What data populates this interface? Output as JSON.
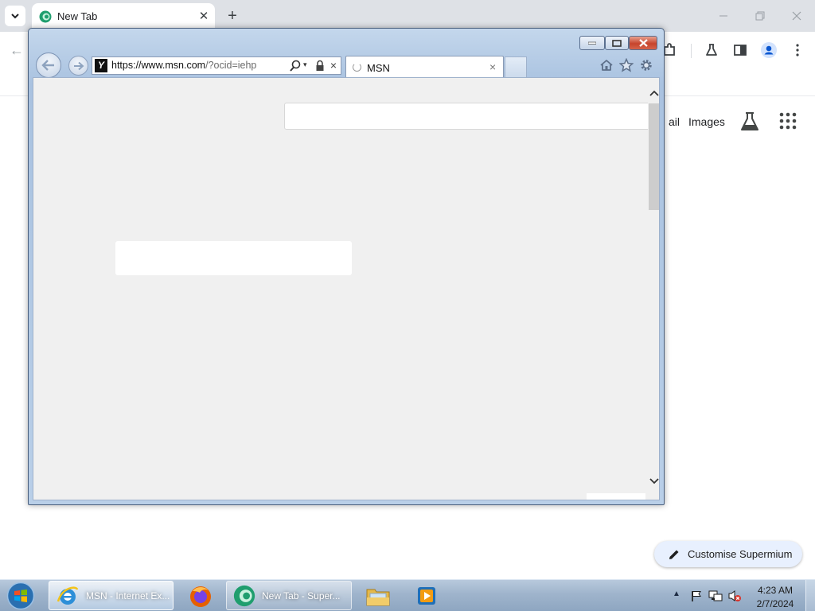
{
  "chrome": {
    "tab_title": "New Tab",
    "tab_close": "✕",
    "new_tab": "+",
    "back": "←",
    "links": {
      "gmail": "ail",
      "images": "Images"
    },
    "customise_label": "Customise Supermium",
    "accent_color": "#1a73e8"
  },
  "ie": {
    "url_prefix": "https://www.",
    "url_domain": "msn.com",
    "url_suffix": "/?ocid=iehp",
    "favicon_letter": "Y",
    "tab_title": "MSN",
    "tab_close": "×",
    "stop_glyph": "×",
    "dropdown_glyph": "▾"
  },
  "taskbar": {
    "items": [
      {
        "label": "MSN - Internet Ex..."
      },
      {
        "label": "Firefox"
      },
      {
        "label": "New Tab - Super..."
      },
      {
        "label": "Windows Explorer"
      },
      {
        "label": "Media Player"
      }
    ],
    "tray_arrow": "▲",
    "clock_time": "4:23 AM",
    "clock_date": "2/7/2024"
  }
}
